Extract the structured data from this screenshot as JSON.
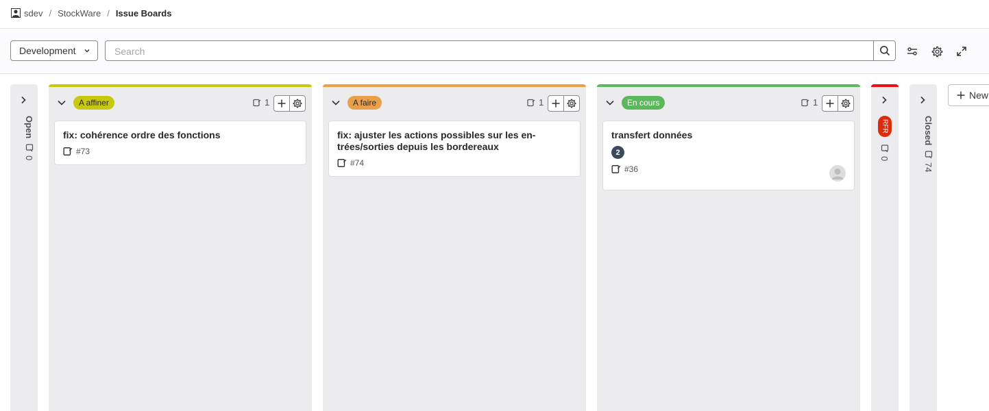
{
  "breadcrumb": {
    "group": "sdev",
    "project": "StockWare",
    "current": "Issue Boards"
  },
  "toolbar": {
    "board_name": "Development",
    "search_placeholder": "Search"
  },
  "lists": {
    "open": {
      "title": "Open",
      "count": "0"
    },
    "a_affiner": {
      "label": "A affiner",
      "label_color": "#c8c80f",
      "count": "1",
      "cards": [
        {
          "title": "fix: cohérence ordre des fonctions",
          "ref": "#73"
        }
      ]
    },
    "a_faire": {
      "label": "A faire",
      "label_color": "#e9a04a",
      "count": "1",
      "cards": [
        {
          "title": "fix: ajuster les actions possibles sur les en-trées/sorties depuis les bordereaux",
          "ref": "#74"
        }
      ]
    },
    "en_cours": {
      "label": "En cours",
      "label_color": "#5cb85c",
      "count": "1",
      "cards": [
        {
          "title": "transfert données",
          "weight": "2",
          "ref": "#36"
        }
      ]
    },
    "rfr": {
      "label": "RFR",
      "label_color": "#e81010",
      "count": "0"
    },
    "closed": {
      "title": "Closed",
      "count": "74"
    }
  },
  "new_list_label": "New"
}
